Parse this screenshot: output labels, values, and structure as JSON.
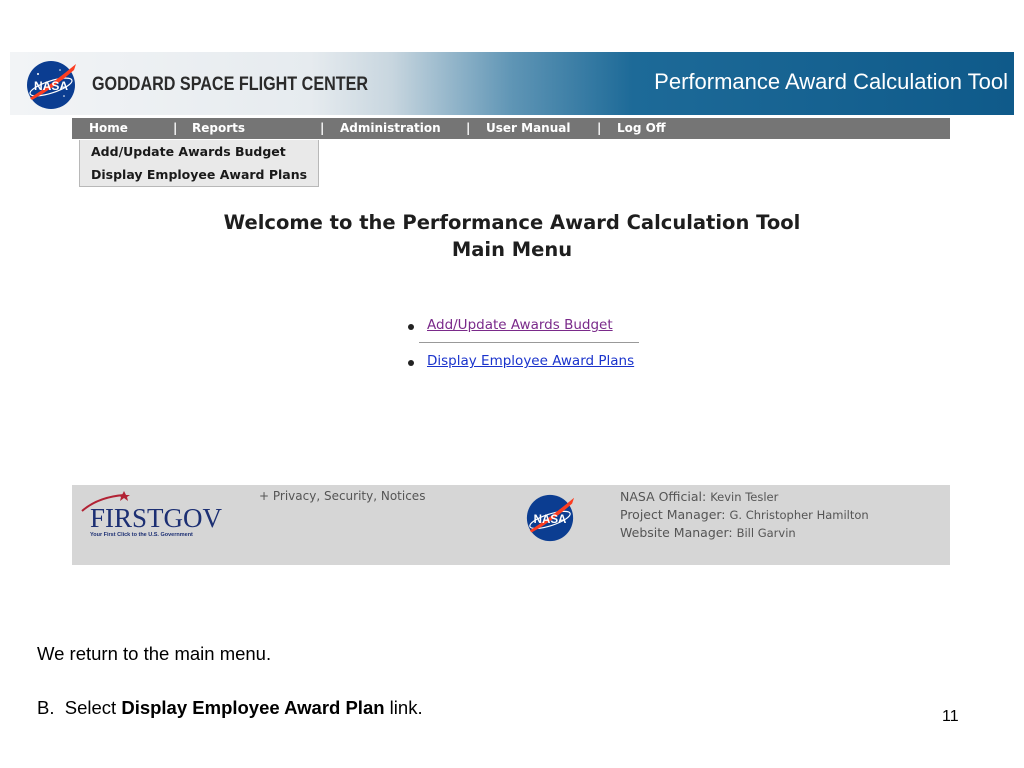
{
  "banner": {
    "center_name": "GODDARD SPACE FLIGHT CENTER",
    "tool_title": "Performance Award Calculation Tool",
    "logo_text": "NASA"
  },
  "nav": {
    "items": [
      "Home",
      "Reports",
      "Administration",
      "User Manual",
      "Log Off"
    ]
  },
  "dropdown": {
    "items": [
      "Add/Update Awards Budget",
      "Display Employee Award Plans"
    ]
  },
  "main": {
    "welcome": "Welcome to the Performance Award Calculation Tool",
    "subtitle": "Main Menu",
    "links": [
      "Add/Update Awards Budget",
      "Display Employee Award Plans"
    ]
  },
  "footer": {
    "firstgov_word": "FIRSTGOV",
    "firstgov_tagline": "Your First Click to the U.S. Government",
    "privacy": "+ Privacy, Security, Notices",
    "officials": [
      {
        "role": "NASA Official:",
        "name": "Kevin Tesler"
      },
      {
        "role": "Project Manager:",
        "name": "G. Christopher Hamilton"
      },
      {
        "role": "Website Manager:",
        "name": "Bill Garvin"
      }
    ]
  },
  "slide": {
    "note": "We return to the main menu.",
    "step_prefix": "B.  Select ",
    "step_bold": "Display Employee Award Plan",
    "step_suffix": " link.",
    "page_number": "11"
  },
  "colors": {
    "nav_bg": "#757575",
    "link_visited": "#7a2a8a",
    "link": "#1a33cc",
    "footer_bg": "#d6d6d6"
  }
}
